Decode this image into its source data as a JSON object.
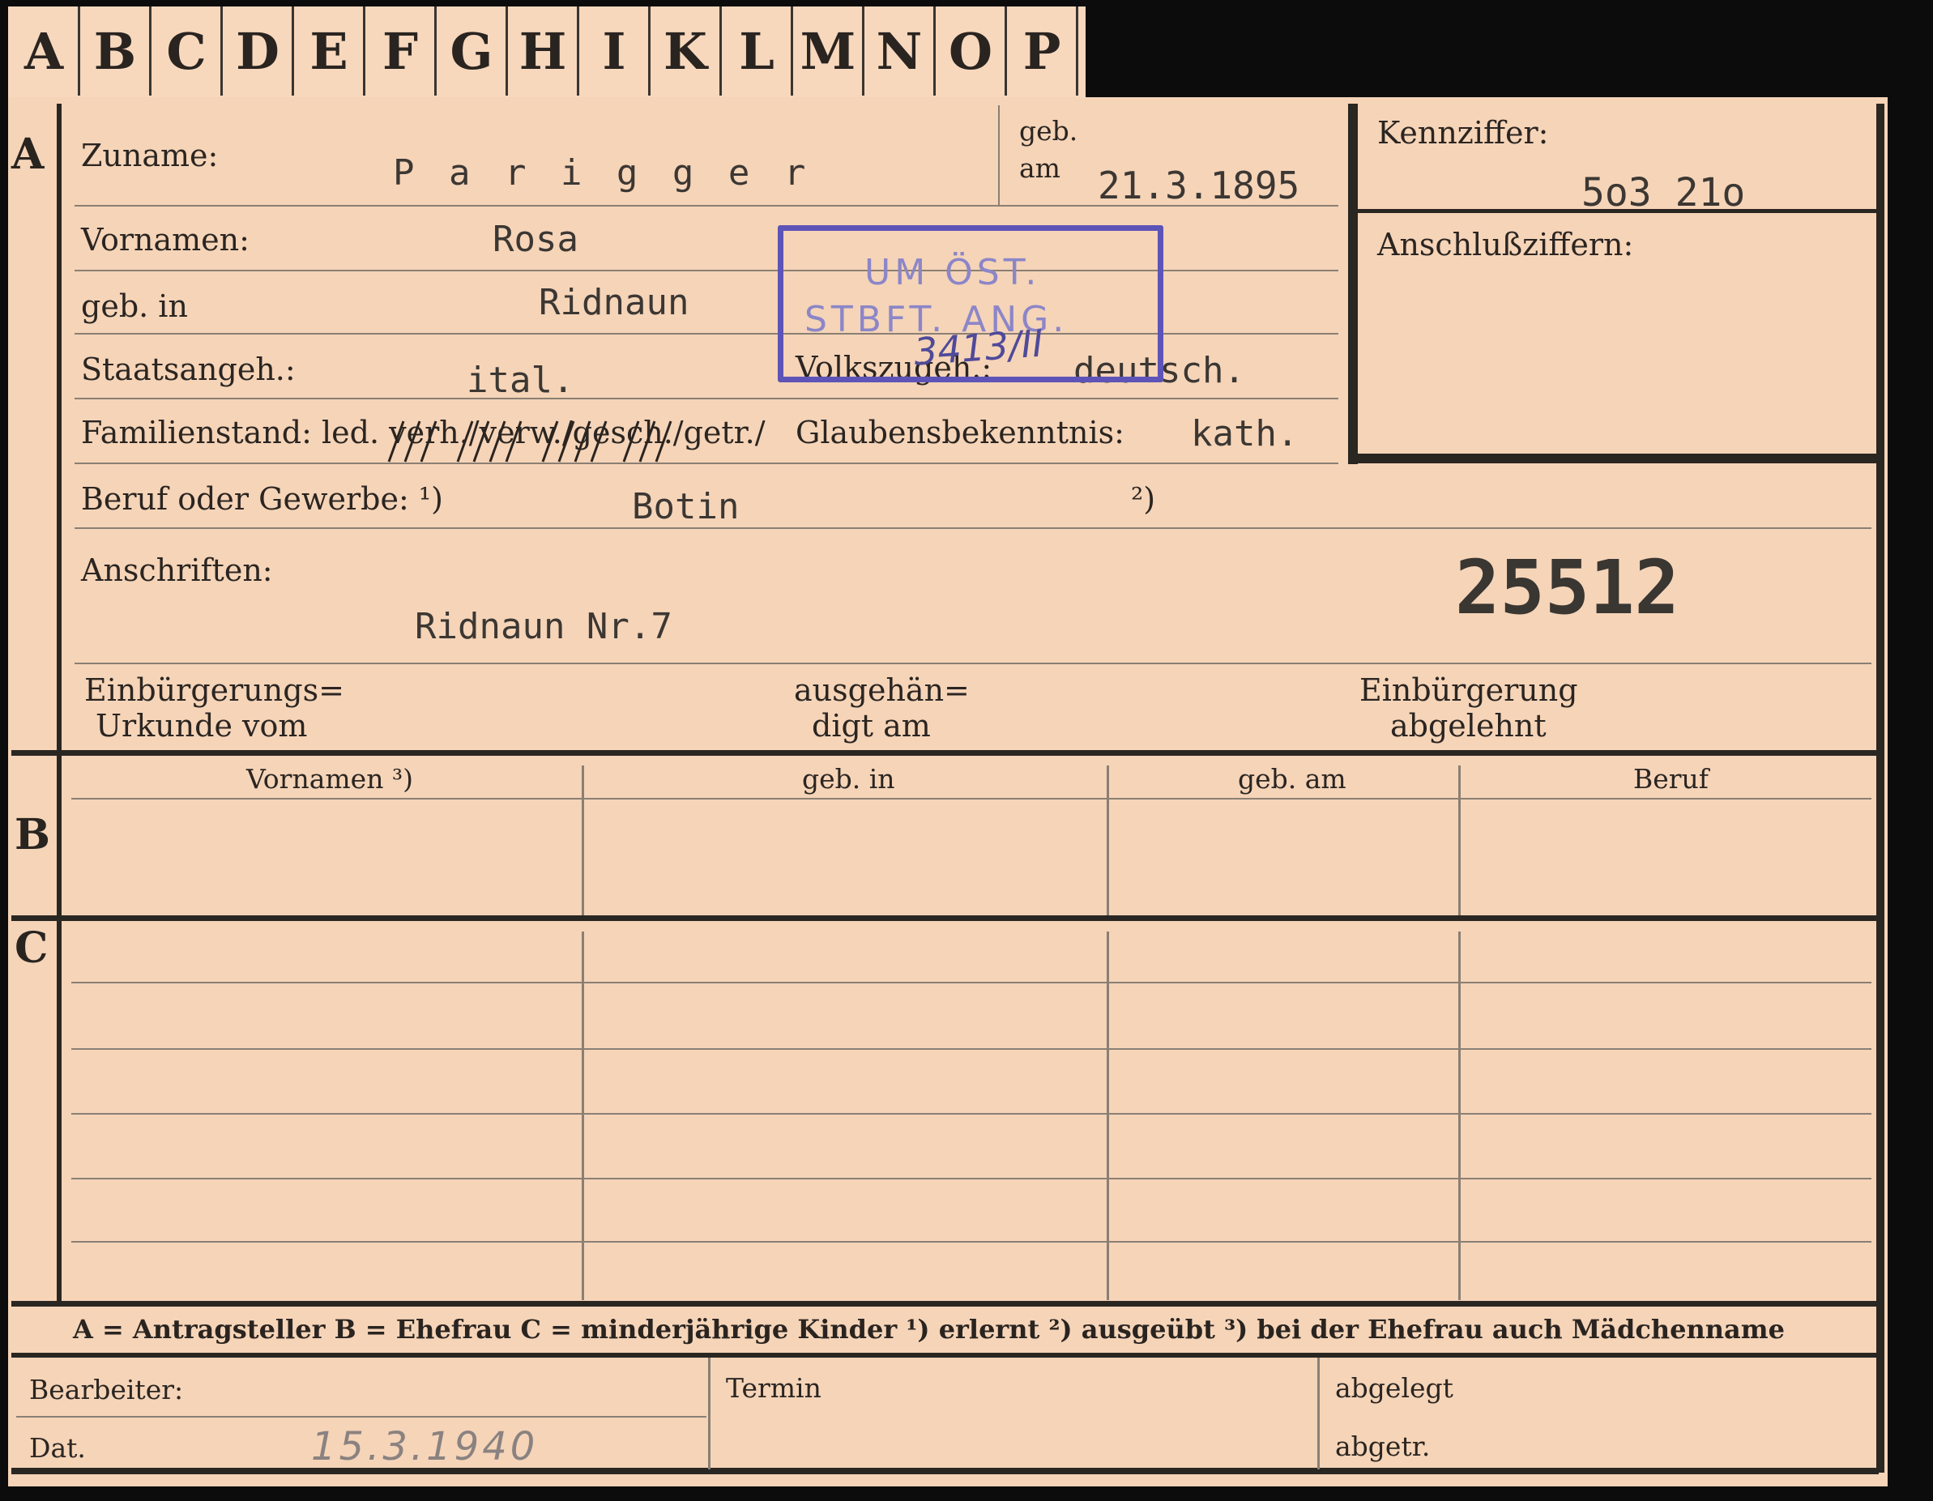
{
  "tabs": [
    "A",
    "B",
    "C",
    "D",
    "E",
    "F",
    "G",
    "H",
    "I",
    "K",
    "L",
    "M",
    "N",
    "O",
    "P"
  ],
  "sections": {
    "a": "A",
    "b": "B",
    "c": "C"
  },
  "labels": {
    "zuname": "Zuname:",
    "geb": "geb.",
    "am": "am",
    "kennziffer": "Kennziffer:",
    "vornamen": "Vornamen:",
    "anschlussziffern": "Anschlußziffern:",
    "geb_in": "geb. in",
    "staatsangeh": "Staatsangeh.:",
    "volkszugeh": "Volkszugeh.:",
    "familienstand": "Familienstand: led. verh./verw./gesch./getr./",
    "glaubensbekenntnis": "Glaubensbekenntnis:",
    "beruf_oder_gewerbe": "Beruf oder Gewerbe: ¹)",
    "footnote2": "²)",
    "anschriften": "Anschriften:",
    "einbuergerungs_urkunde_1": "Einbürgerungs=",
    "einbuergerungs_urkunde_2": "Urkunde vom",
    "ausgehaendigt_1": "ausgehän=",
    "ausgehaendigt_2": "digt am",
    "einbuergerung_abgelehnt_1": "Einbürgerung",
    "einbuergerung_abgelehnt_2": "abgelehnt"
  },
  "values": {
    "surname": "P a r i g g e r",
    "birth_date": "21.3.1895",
    "kennziffer": "5o3 21o",
    "first_names": "Rosa",
    "birthplace": "Ridnaun",
    "citizenship": "ital.",
    "nationality": "deutsch.",
    "religion": "kath.",
    "occupation": "Botin",
    "address": "Ridnaun Nr.7",
    "file_number": "25512"
  },
  "stamp": {
    "line1": "UM ÖST.",
    "line2": "STBFT. ANG.",
    "annotation": "3413/II"
  },
  "table_headers": [
    "Vornamen ³)",
    "geb. in",
    "geb. am",
    "Beruf"
  ],
  "legend": "A = Antragsteller   B = Ehefrau   C = minderjährige Kinder   ¹) erlernt   ²) ausgeübt   ³) bei der Ehefrau auch Mädchenname",
  "footer": {
    "bearbeiter": "Bearbeiter:",
    "termin": "Termin",
    "abgelegt": "abgelegt",
    "dat": "Dat.",
    "dat_value": "15.3.1940",
    "abgetr": "abgetr."
  },
  "colors": {
    "card": "#f5d4b8",
    "stamp": "#5e54b8",
    "rule": "#2a2622"
  }
}
